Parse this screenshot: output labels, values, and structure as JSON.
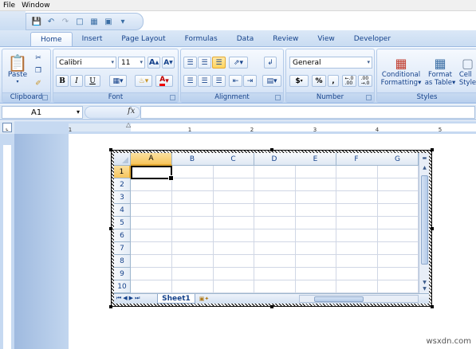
{
  "menu": {
    "items": [
      "File",
      "Window"
    ]
  },
  "ribbon": {
    "tabs": [
      "Home",
      "Insert",
      "Page Layout",
      "Formulas",
      "Data",
      "Review",
      "View",
      "Developer"
    ],
    "active_tab": "Home",
    "clipboard": {
      "label": "Clipboard",
      "paste": "Paste"
    },
    "font": {
      "label": "Font",
      "name": "Calibri",
      "size": "11",
      "bold": "B",
      "italic": "I",
      "underline": "U"
    },
    "alignment": {
      "label": "Alignment"
    },
    "number": {
      "label": "Number",
      "format": "General",
      "currency": "$",
      "percent": "%",
      "comma": ",",
      "inc_decimal": "+.0\n.00",
      "dec_decimal": ".00\n→.0"
    },
    "styles": {
      "label": "Styles",
      "conditional": "Conditional Formatting",
      "format_table": "Format as Table",
      "cell_styles": "Cell Style"
    }
  },
  "formula_bar": {
    "name_box": "A1",
    "fx": "fx",
    "value": ""
  },
  "ruler": {
    "ticks": [
      "1",
      "1",
      "2",
      "3",
      "4",
      "5"
    ]
  },
  "sheet": {
    "columns": [
      "A",
      "B",
      "C",
      "D",
      "E",
      "F",
      "G"
    ],
    "rows": [
      "1",
      "2",
      "3",
      "4",
      "5",
      "6",
      "7",
      "8",
      "9",
      "10"
    ],
    "active_cell": "A1",
    "tab_name": "Sheet1"
  },
  "watermark": "wsxdn.com"
}
